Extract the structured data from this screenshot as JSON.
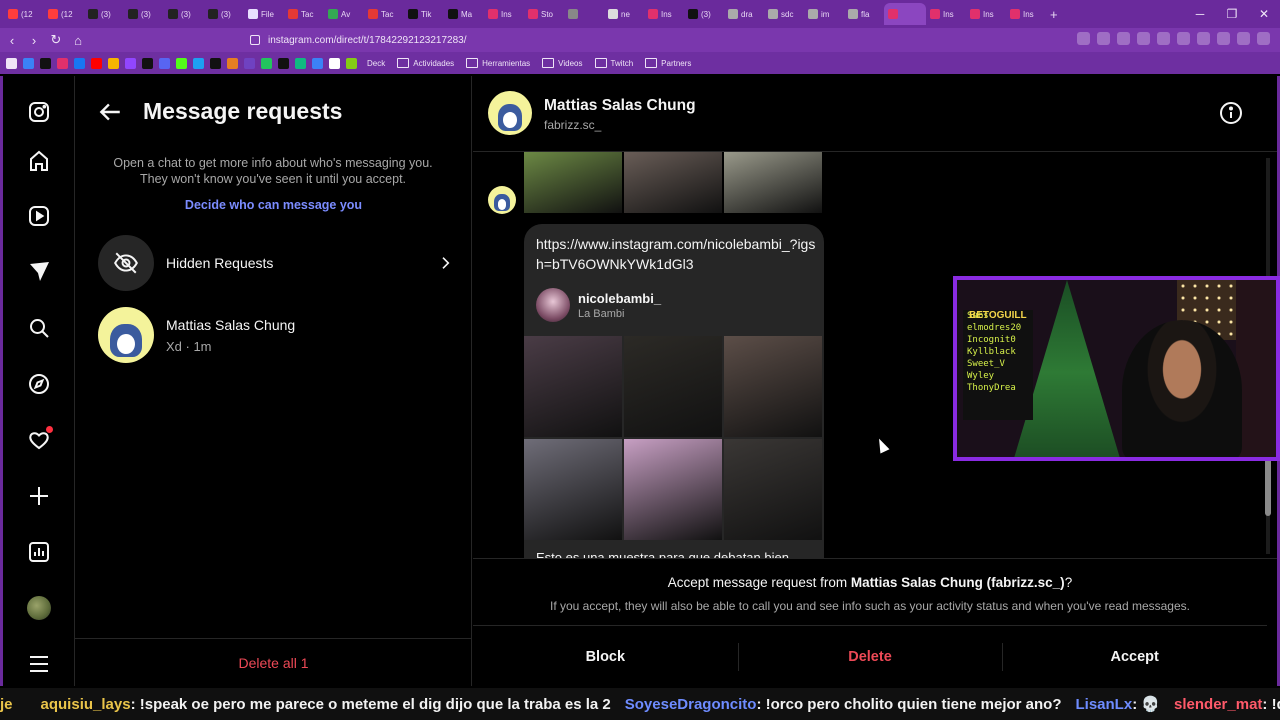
{
  "browser": {
    "tabs": [
      "(12",
      "(12",
      "(3)",
      "(3)",
      "(3)",
      "(3)",
      "File",
      "Tac",
      "Av",
      "Tac",
      "Tik",
      "Ma",
      "Ins",
      "Sto",
      "",
      "ne",
      "Ins",
      "(3)",
      "dra",
      "sdc",
      "im",
      "fla",
      "",
      "Ins",
      "Ins",
      "Ins"
    ],
    "tab_colors": [
      "#ff3d3d",
      "#ff3d3d",
      "#222222",
      "#222222",
      "#222222",
      "#222222",
      "#e8e0ff",
      "#e53935",
      "#34a853",
      "#e53935",
      "#111111",
      "#111111",
      "#e1306c",
      "#e1306c",
      "#888888",
      "#dddddd",
      "#e1306c",
      "#111111",
      "#aaaaaa",
      "#aaaaaa",
      "#aaaaaa",
      "#aaaaaa",
      "#e1306c",
      "#e1306c",
      "#e1306c",
      "#e1306c"
    ],
    "url": "instagram.com/direct/t/17842292123217283/",
    "bookmarks": [
      "Deck",
      "Actividades",
      "Herramientas",
      "Videos",
      "Twitch",
      "Partners"
    ],
    "bookmark_icon_colors": [
      "#3b82f6",
      "#111111",
      "#e1306c",
      "#1877f2",
      "#ff0000",
      "#f7b500",
      "#9146ff",
      "#111111",
      "#5865f2",
      "#53fc18",
      "#1da1f2",
      "#111111",
      "#e67e22",
      "#6f42c1",
      "#22c55e",
      "#111111",
      "#10b981",
      "#3b82f6",
      "#ffffff",
      "#84cc16"
    ]
  },
  "requests": {
    "title": "Message requests",
    "info": "Open a chat to get more info about who's messaging you. They won't know you've seen it until you accept.",
    "decide_link": "Decide who can message you",
    "hidden_label": "Hidden Requests",
    "conversation": {
      "name": "Mattias Salas Chung",
      "preview": "Xd · 1m"
    },
    "delete_all": "Delete all 1"
  },
  "chat": {
    "name": "Mattias Salas Chung",
    "username": "fabrizz.sc_",
    "link": "https://www.instagram.com/nicolebambi_?igsh=bTV6OWNkYWk1dGl3",
    "shared_profile": {
      "username": "nicolebambi_",
      "name": "La Bambi"
    },
    "cut_text": "Esto es una muestra para que debatan bien",
    "accept_prefix": "Accept message request from ",
    "accept_name": "Mattias Salas Chung (fabrizz.sc_)",
    "accept_suffix": "?",
    "accept_sub": "If you accept, they will also be able to call you and see info such as your activity status and when you've read messages.",
    "actions": {
      "block": "Block",
      "delete": "Delete",
      "accept": "Accept"
    }
  },
  "thumb_colors_top": [
    "#6d8a45",
    "#6a5e58",
    "#9b9b8c"
  ],
  "thumb_colors_bottom": [
    "#4a3c46",
    "#2c2a26",
    "#5c4e48",
    "#6f6d78",
    "#c79fc3",
    "#3a3735"
  ],
  "webcam": {
    "brand": "BETOGUILL",
    "board_lines": [
      "Subs",
      "elmodres20",
      "Incognit0",
      "Kyllblack",
      "Sweet_V",
      "Wyley",
      "ThonyDrea"
    ]
  },
  "ticker": [
    {
      "user": "je",
      "msg": ""
    },
    {
      "user": "aquisiu_lays",
      "msg": ": !speak oe pero me parece o meteme el dig dijo que la traba es la 2"
    },
    {
      "user": "SoyeseDragoncito",
      "msg": ": !orco pero cholito quien tiene mejor ano?"
    },
    {
      "user": "LisanLx",
      "msg": ": 💀"
    },
    {
      "user": "slender_mat",
      "msg": ": !daarick w"
    }
  ]
}
